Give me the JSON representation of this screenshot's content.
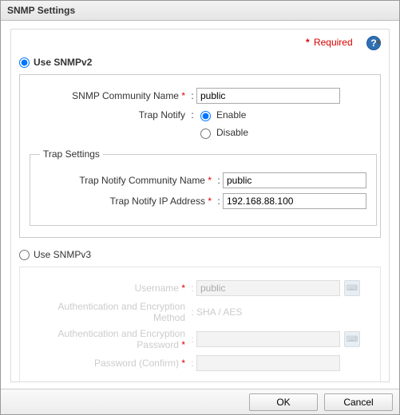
{
  "title": "SNMP Settings",
  "required_label": "Required",
  "help_symbol": "?",
  "snmp_version": "v2",
  "v2": {
    "radio_label": "Use SNMPv2",
    "community_label": "SNMP Community Name",
    "community_value": "public",
    "trap_notify_label": "Trap Notify",
    "trap_notify_value": "enable",
    "enable_label": "Enable",
    "disable_label": "Disable",
    "trap_settings_legend": "Trap Settings",
    "trap_community_label": "Trap Notify Community Name",
    "trap_community_value": "public",
    "trap_ip_label": "Trap Notify IP Address",
    "trap_ip_value": "192.168.88.100"
  },
  "v3": {
    "radio_label": "Use SNMPv3",
    "username_label": "Username",
    "username_value": "public",
    "auth_method_label": "Authentication and Encryption Method",
    "auth_method_value": "SHA / AES",
    "auth_password_label": "Authentication and Encryption Password",
    "auth_password_value": "",
    "confirm_label": "Password (Confirm)",
    "confirm_value": ""
  },
  "buttons": {
    "ok": "OK",
    "cancel": "Cancel"
  }
}
